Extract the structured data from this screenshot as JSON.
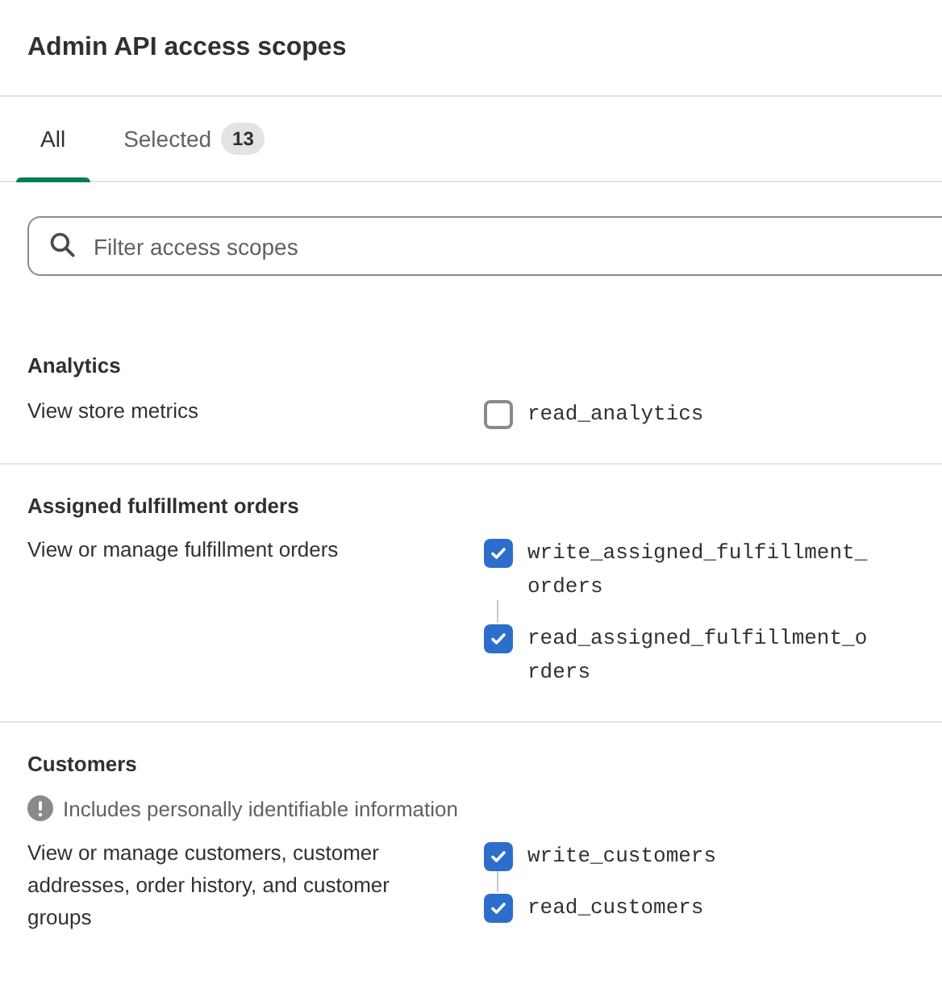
{
  "title": "Admin API access scopes",
  "tabs": [
    {
      "label": "All",
      "selected": true
    },
    {
      "label": "Selected",
      "badge": "13",
      "selected": false
    }
  ],
  "search": {
    "placeholder": "Filter access scopes"
  },
  "sections": [
    {
      "title": "Analytics",
      "description": "View store metrics",
      "scopes": [
        {
          "name": "read_analytics",
          "checked": false
        }
      ]
    },
    {
      "title": "Assigned fulfillment orders",
      "description": "View or manage fulfillment orders",
      "scopes": [
        {
          "name": "write_assigned_fulfillment_orders",
          "checked": true
        },
        {
          "name": "read_assigned_fulfillment_orders",
          "checked": true
        }
      ]
    },
    {
      "title": "Customers",
      "notice": "Includes personally identifiable information",
      "description": "View or manage customers, customer addresses, order history, and customer groups",
      "scopes": [
        {
          "name": "write_customers",
          "checked": true
        },
        {
          "name": "read_customers",
          "checked": true
        }
      ]
    }
  ]
}
